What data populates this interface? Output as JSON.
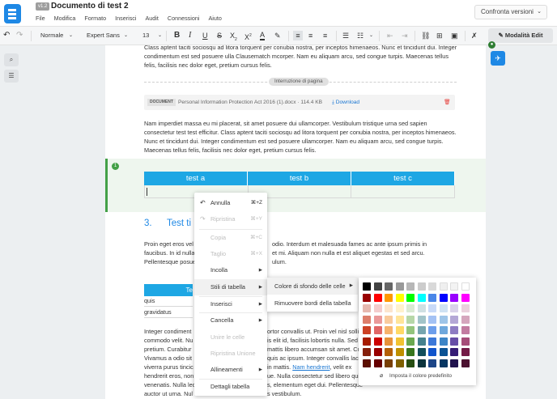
{
  "app": {
    "version_badge": "v1.2",
    "title": "Documento di test 2",
    "menu": [
      "File",
      "Modifica",
      "Formato",
      "Inserisci",
      "Audit",
      "Connessioni",
      "Aiuto"
    ],
    "compare_label": "Confronta versioni"
  },
  "toolbar": {
    "style": "Normale",
    "font": "Expert Sans",
    "size": "13",
    "edit_mode": "Modalità Edit"
  },
  "doc": {
    "para1": "Class aptent taciti sociosqu ad litora torquent per conubia nostra, per inceptos himenaeos. Nunc et tincidunt dui. Integer condimentum est sed posuere ulla Clausematch mcorper. Nam eu aliquam arcu, sed congue turpis. Maecenas tellus felis, facilisis nec dolor eget, pretium cursus felis.",
    "page_break": "Interruzione di pagina",
    "attachment": {
      "tag": "DOCUMENT",
      "name": "Personal Information Protection Act 2016 (1).docx",
      "size": "114.4 KB",
      "download": "Download"
    },
    "para2": "Nam imperdiet massa eu mi placerat, sit amet posuere dui ullamcorper. Vestibulum tristique urna sed sapien consectetur test test efficitur. Class aptent taciti sociosqu ad litora torquent per conubia nostra, per inceptos himenaeos. Nunc et tincidunt dui. Integer condimentum est sed posuere ullamcorper. Nam eu aliquam arcu, sed congue turpis. Maecenas tellus felis, facilisis nec dolor eget, pretium cursus felis.",
    "section_num": "1",
    "table_headers": [
      "test a",
      "test b",
      "test c"
    ],
    "heading_num": "3.",
    "heading_text": "Test ti",
    "para3a": "Proin eget eros vel",
    "para3a_r": "odio. Interdum et malesuada fames ac ante ipsum primis in",
    "para3b": "faucibus. In id nulla",
    "para3b_r": "et mi. Aliquam non nulla et est aliquet egestas et sed arcu.",
    "para3c": "Pellentesque posue",
    "para3c_r": "ulum.",
    "mini_head": "Te",
    "mini_r1": "quis",
    "mini_r2": "gravidatus",
    "para4a": "Integer condiment",
    "para4a_r": "ortor convallis ut. Proin vel nisl sollic",
    "para4b": "commodo velit. Nu",
    "para4b_r": "is elit id, facilisis lobortis nulla. Sed",
    "para4c": "pretium. Curabitur",
    "para4c_r": "mattis libero accumsan sit amet. Cu",
    "para4d": "Vivamus a odio sit",
    "para4d_r": "quis ac ipsum. Integer convallis lacin",
    "para4e": "viverra purus tincic",
    "para4e_r": "in mattis.",
    "para4e_link": "Nam hendrerit",
    "para4e_rr": ", velit ex",
    "para4f": "hendrerit eros, non",
    "para4f_r": "ue. Nulla consectetur sed libero quis",
    "para4g": "venenatis. Nulla lec",
    "para4g_r": "s, elementum eget dui. Pellentesque",
    "para4h": "auctor ut urna. Nul",
    "para4h_r": "s vestibulum."
  },
  "context_menu": {
    "undo": "Annulla",
    "undo_sc": "⌘+Z",
    "redo": "Ripristina",
    "redo_sc": "⌘+Y",
    "copy": "Copia",
    "copy_sc": "⌘+C",
    "cut": "Taglio",
    "cut_sc": "⌘+X",
    "paste": "Incolla",
    "table_styles": "Stili di tabella",
    "insert": "Inserisci",
    "delete": "Cancella",
    "merge": "Unire le celle",
    "unmerge": "Ripristina Unione",
    "align": "Allineamenti",
    "table_details": "Dettagli tabella"
  },
  "submenu": {
    "bg_color": "Colore di sfondo delle celle",
    "remove_borders": "Rimuovere bordi della tabella"
  },
  "palette": {
    "default_label": "Imposta il colore predefinito",
    "rows": [
      [
        "#000000",
        "#434343",
        "#666666",
        "#999999",
        "#b7b7b7",
        "#cccccc",
        "#d9d9d9",
        "#efefef",
        "#f3f3f3",
        "#ffffff"
      ],
      [
        "#980000",
        "#ff0000",
        "#ff9900",
        "#ffff00",
        "#00ff00",
        "#00ffff",
        "#4a86e8",
        "#0000ff",
        "#9900ff",
        "#ff00ff"
      ],
      [
        "#e6b8af",
        "#f4cccc",
        "#fce5cd",
        "#fff2cc",
        "#d9ead3",
        "#d0e0e3",
        "#c9daf8",
        "#cfe2f3",
        "#d9d2e9",
        "#ead1dc"
      ],
      [
        "#dd7e6b",
        "#ea9999",
        "#f9cb9c",
        "#ffe599",
        "#b6d7a8",
        "#a2c4c9",
        "#a4c2f4",
        "#9fc5e8",
        "#b4a7d6",
        "#d5a6bd"
      ],
      [
        "#cc4125",
        "#e06666",
        "#f6b26b",
        "#ffd966",
        "#93c47d",
        "#76a5af",
        "#6d9eeb",
        "#6fa8dc",
        "#8e7cc3",
        "#c27ba0"
      ],
      [
        "#a61c00",
        "#cc0000",
        "#e69138",
        "#f1c232",
        "#6aa84f",
        "#45818e",
        "#3c78d8",
        "#3d85c6",
        "#674ea7",
        "#a64d79"
      ],
      [
        "#85200c",
        "#990000",
        "#b45f06",
        "#bf9000",
        "#38761d",
        "#134f5c",
        "#1155cc",
        "#0b5394",
        "#351c75",
        "#741b47"
      ],
      [
        "#5b0f00",
        "#660000",
        "#783f04",
        "#7f6000",
        "#274e13",
        "#0c343d",
        "#1c4587",
        "#073763",
        "#20124d",
        "#4c1130"
      ]
    ]
  }
}
